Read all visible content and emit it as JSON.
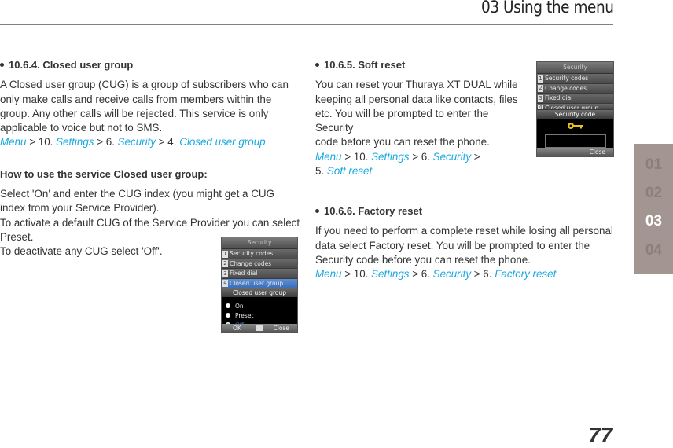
{
  "header": {
    "chapter_title": "03 Using the menu"
  },
  "side_tabs": [
    {
      "label": "01",
      "active": false
    },
    {
      "label": "02",
      "active": false
    },
    {
      "label": "03",
      "active": true
    },
    {
      "label": "04",
      "active": false
    }
  ],
  "page_number": "77",
  "left_column": {
    "section_heading": "10.6.4. Closed user group",
    "intro": "A Closed user group (CUG) is a group of subscribers who can only make calls and receive calls from members within the group. Any other calls will be rejected. This service is only applicable to voice but not to SMS.",
    "path": {
      "menu": "Menu",
      "sep1": " > 10. ",
      "settings": "Settings",
      "sep2": " > 6. ",
      "security": "Security",
      "sep3": " > 4. ",
      "target": "Closed user group"
    },
    "howto_heading": "How to use the service Closed user group:",
    "howto_lines": [
      "Select 'On' and enter the CUG index (you might get a CUG",
      "index from your Service Provider).",
      "To activate a default CUG of the Service Provider you can select",
      "Preset.",
      "To deactivate any CUG select 'Off'."
    ],
    "phone_screen": {
      "title": "Security",
      "menu_items": [
        {
          "num": "1",
          "label": "Security codes"
        },
        {
          "num": "2",
          "label": "Change codes"
        },
        {
          "num": "3",
          "label": "Fixed dial"
        },
        {
          "num": "4",
          "label": "Closed user group",
          "selected": true
        }
      ],
      "subtitle": "Closed user group",
      "options": [
        {
          "label": "On",
          "selected": false
        },
        {
          "label": "Preset",
          "selected": false
        },
        {
          "label": "Off",
          "selected": true
        }
      ],
      "softkey_left": "OK",
      "softkey_right": "Close"
    }
  },
  "right_column": {
    "soft_reset": {
      "heading": "10.6.5. Soft reset",
      "lines": [
        "You can reset your Thuraya XT DUAL while",
        "keeping all personal data like contacts, files",
        "etc. You will be prompted to enter the Security",
        "code before you can reset the phone."
      ],
      "path": {
        "menu": "Menu",
        "sep1": " > 10. ",
        "settings": "Settings",
        "sep2": " > 6. ",
        "security": "Security",
        "sep3": " >",
        "sep4": "5. ",
        "target": "Soft reset"
      },
      "phone_screen": {
        "title": "Security",
        "menu_items": [
          {
            "num": "1",
            "label": "Security codes"
          },
          {
            "num": "2",
            "label": "Change codes"
          },
          {
            "num": "3",
            "label": "Fixed dial"
          },
          {
            "num": "4",
            "label": "Closed user group"
          }
        ],
        "subtitle": "Security code",
        "icon": "key-icon",
        "softkey_right": "Close"
      }
    },
    "factory_reset": {
      "heading": "10.6.6. Factory reset",
      "lines": [
        "If you need to perform a complete reset while losing all personal",
        "data select Factory reset. You will be prompted to enter the",
        "Security code before you can reset the phone."
      ],
      "path": {
        "menu": "Menu",
        "sep1": " > 10. ",
        "settings": "Settings",
        "sep2": " > 6. ",
        "security": "Security",
        "sep3": " > 6. ",
        "target": "Factory reset"
      }
    }
  },
  "colors": {
    "link": "#1aa8e0",
    "side_tab_bg": "#a39591",
    "header_rule": "#8a7f7c"
  }
}
